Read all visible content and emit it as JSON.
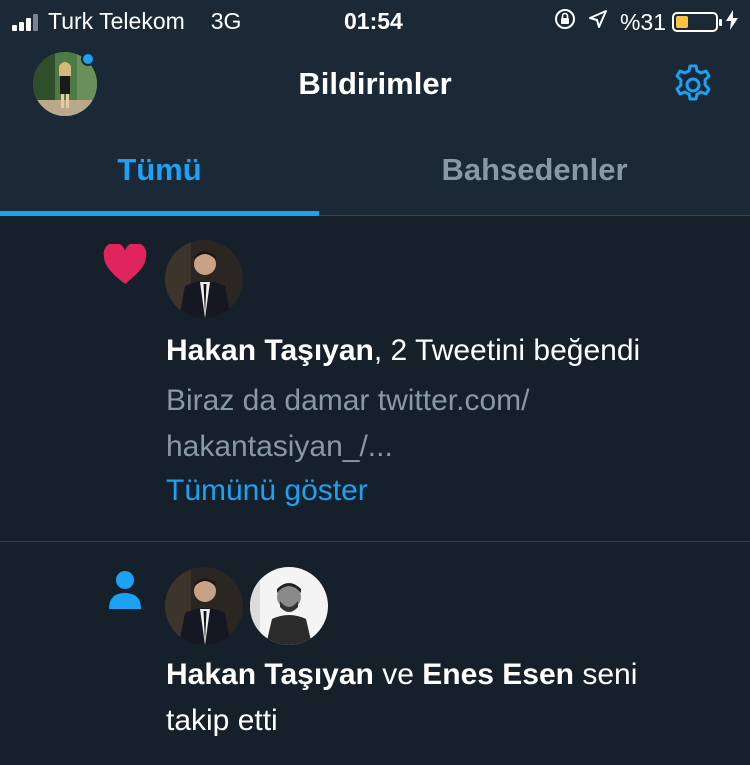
{
  "status_bar": {
    "carrier": "Turk Telekom",
    "network": "3G",
    "time": "01:54",
    "battery_text": "%31",
    "battery_level": 0.31,
    "icons": [
      "signal-icon",
      "rotation-lock-icon",
      "location-arrow-icon",
      "battery-icon",
      "charging-bolt-icon"
    ]
  },
  "header": {
    "title": "Bildirimler",
    "settings_icon": "gear-icon",
    "accent": "#1da1f2"
  },
  "tabs": [
    {
      "label": "Tümü",
      "active": true
    },
    {
      "label": "Bahsedenler",
      "active": false
    }
  ],
  "notifications": [
    {
      "type_icon": "heart-icon",
      "user": "Hakan Taşıyan",
      "action": ", 2 Tweetini beğendi",
      "preview_line1": "Biraz da damar twitter.com/",
      "preview_line2": "hakantasiyan_/...",
      "show_all": "Tümünü göster"
    },
    {
      "type_icon": "person-icon",
      "user": "Hakan Taşıyan",
      "connector": " ve ",
      "user2": "Enes Esen",
      "action_line1": " seni",
      "action_line2": "takip etti"
    }
  ],
  "colors": {
    "background": "#15202b",
    "bar": "#1b2836",
    "heart": "#e0245e",
    "muted": "#8899a6",
    "divider": "#38444d"
  }
}
